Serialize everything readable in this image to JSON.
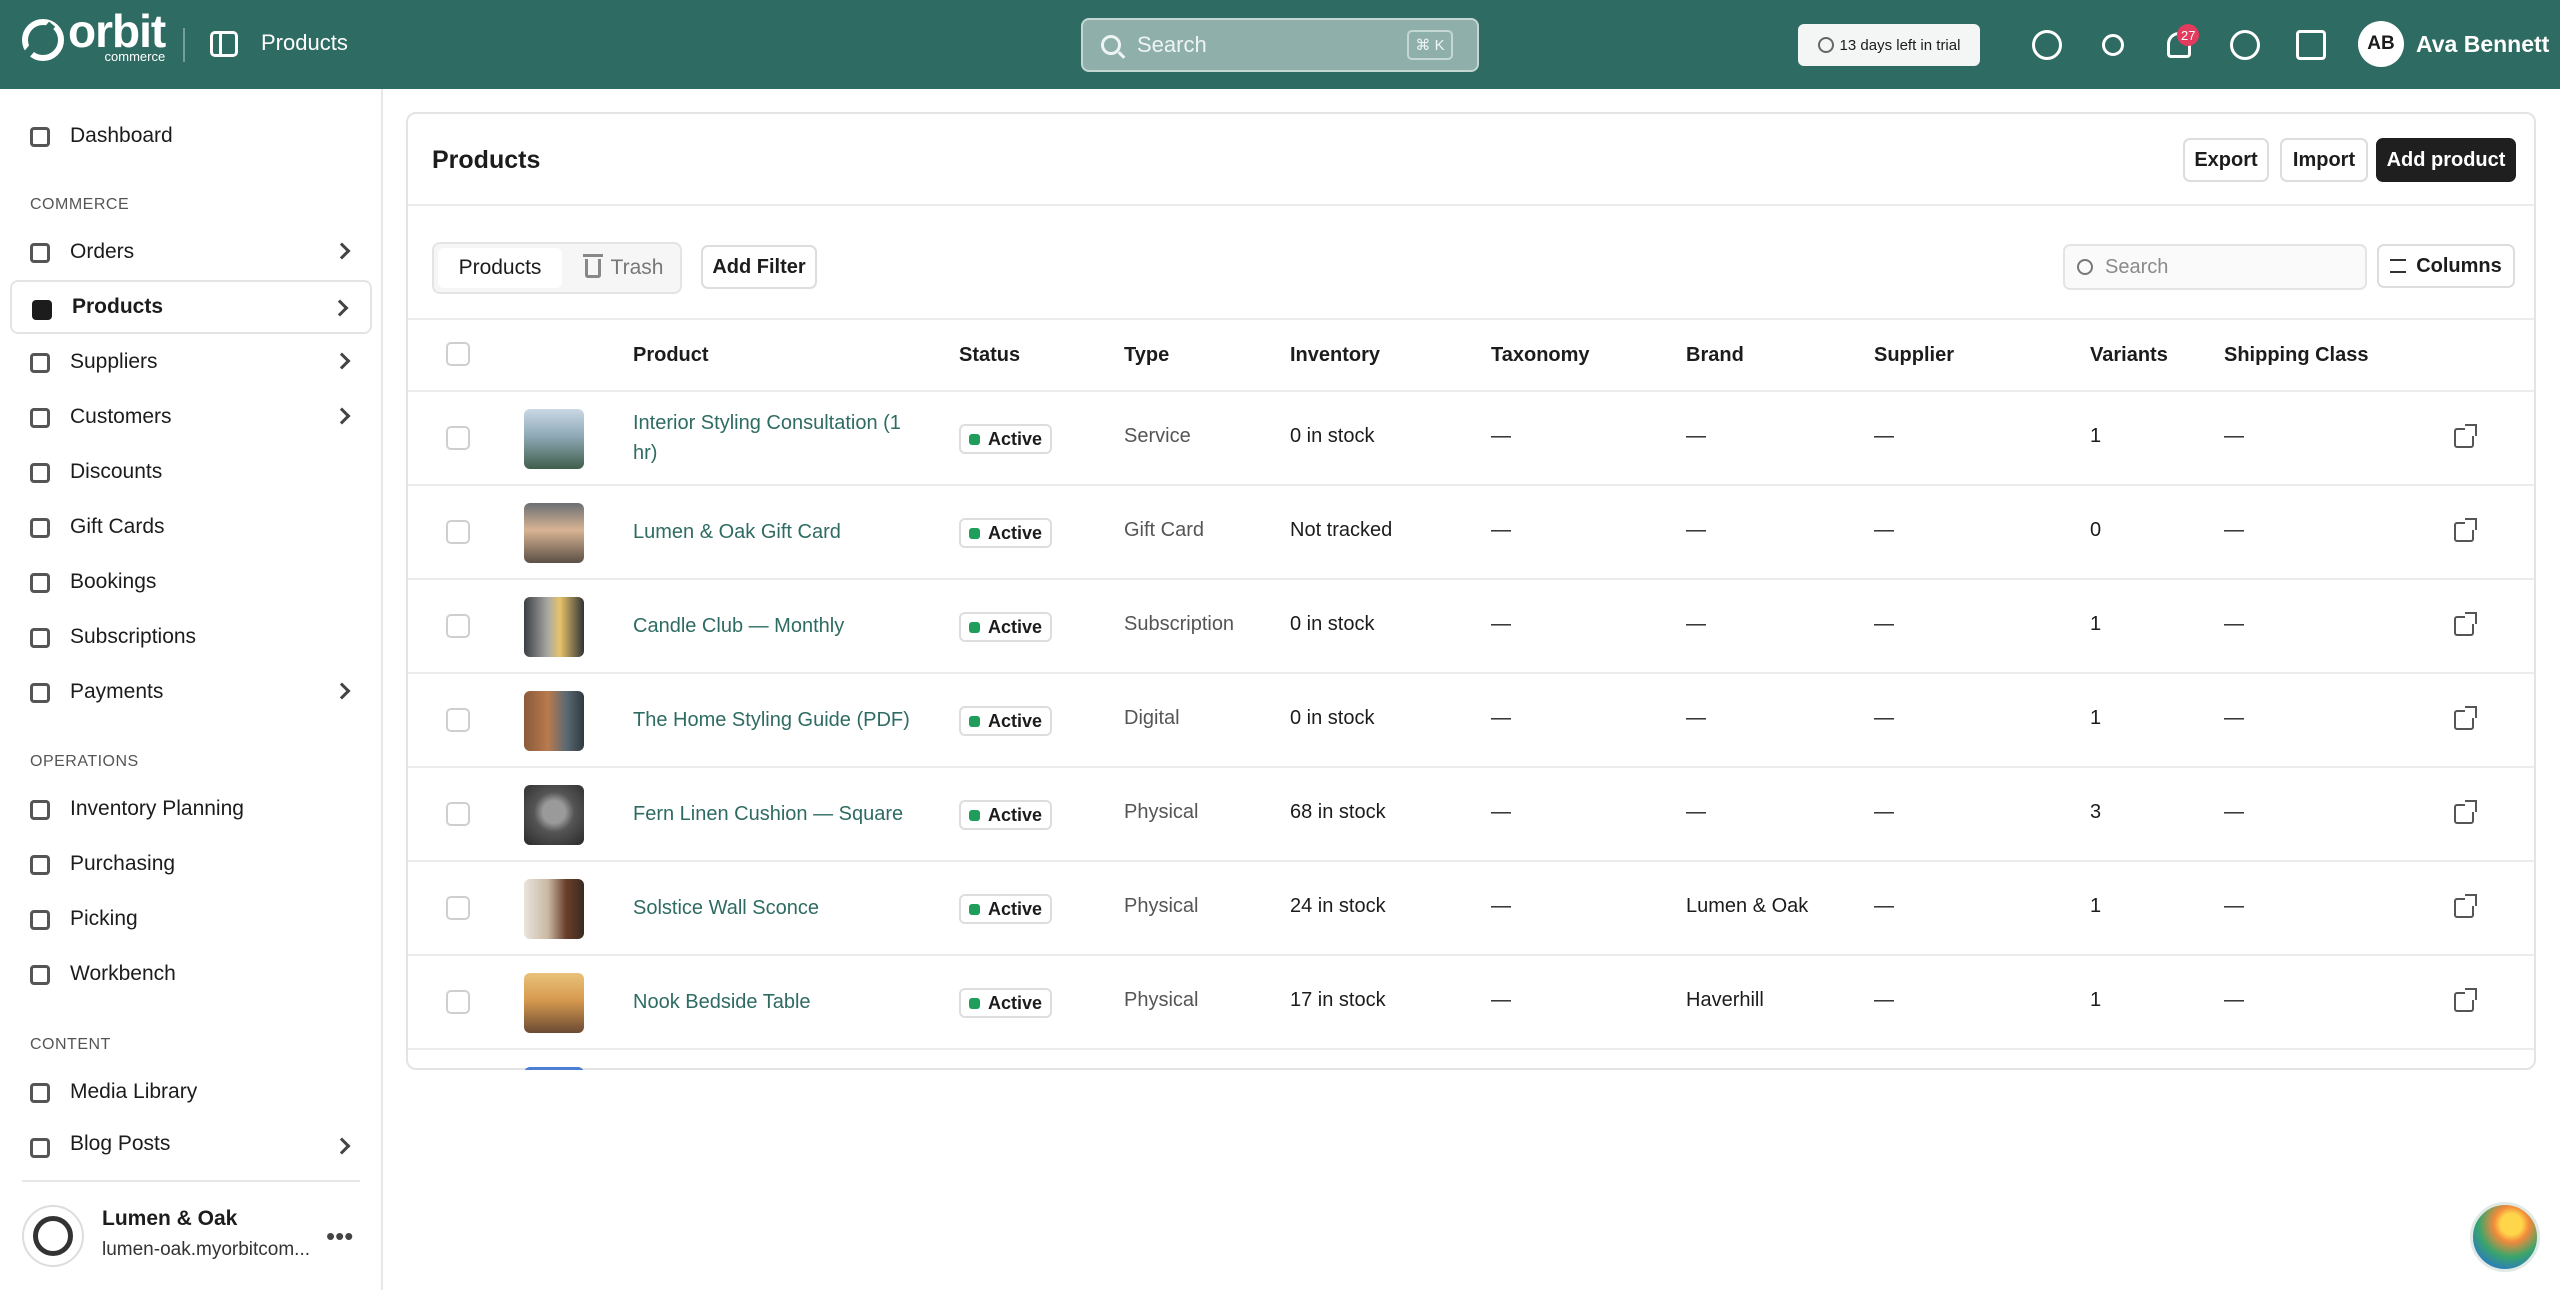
{
  "brand": {
    "name": "orbit",
    "sub": "commerce"
  },
  "topbar": {
    "title": "Products",
    "search_placeholder": "Search",
    "search_shortcut": "⌘ K",
    "trial_text": "13 days left in trial",
    "notifications_count": "27",
    "user_initials": "AB",
    "user_name": "Ava Bennett",
    "icons": [
      "chat-icon",
      "theme-sun-icon",
      "bell-icon",
      "help-icon",
      "store-icon"
    ]
  },
  "sidebar": {
    "top_item": {
      "label": "Dashboard"
    },
    "commerce_label": "COMMERCE",
    "commerce_items": [
      {
        "label": "Orders"
      },
      {
        "label": "Products"
      },
      {
        "label": "Suppliers"
      },
      {
        "label": "Customers"
      },
      {
        "label": "Discounts"
      },
      {
        "label": "Gift Cards"
      },
      {
        "label": "Bookings"
      },
      {
        "label": "Subscriptions"
      },
      {
        "label": "Payments"
      }
    ],
    "operations_label": "OPERATIONS",
    "operations_items": [
      {
        "label": "Inventory Planning"
      },
      {
        "label": "Purchasing"
      },
      {
        "label": "Picking"
      },
      {
        "label": "Workbench"
      }
    ],
    "content_label": "CONTENT",
    "content_items": [
      {
        "label": "Media Library"
      },
      {
        "label": "Blog Posts"
      }
    ],
    "store": {
      "name": "Lumen & Oak",
      "url": "lumen-oak.myorbitcom..."
    }
  },
  "main": {
    "title": "Products",
    "export_label": "Export",
    "import_label": "Import",
    "add_label": "Add product",
    "tab_products": "Products",
    "tab_trash": "Trash",
    "add_filter_label": "Add Filter",
    "search_placeholder": "Search",
    "columns_label": "Columns",
    "headers": [
      "Product",
      "Status",
      "Type",
      "Inventory",
      "Taxonomy",
      "Brand",
      "Supplier",
      "Variants",
      "Shipping Class"
    ],
    "rows": [
      {
        "name": "Interior Styling Consultation (1 hr)",
        "status": "Active",
        "type": "Service",
        "inventory": "0  in stock",
        "taxonomy": "—",
        "brand": "—",
        "supplier": "—",
        "variants": "1",
        "shipping": "—"
      },
      {
        "name": "Lumen & Oak Gift Card",
        "status": "Active",
        "type": "Gift Card",
        "inventory": "Not tracked",
        "taxonomy": "—",
        "brand": "—",
        "supplier": "—",
        "variants": "0",
        "shipping": "—"
      },
      {
        "name": "Candle Club — Monthly",
        "status": "Active",
        "type": "Subscription",
        "inventory": "0  in stock",
        "taxonomy": "—",
        "brand": "—",
        "supplier": "—",
        "variants": "1",
        "shipping": "—"
      },
      {
        "name": "The Home Styling Guide (PDF)",
        "status": "Active",
        "type": "Digital",
        "inventory": "0  in stock",
        "taxonomy": "—",
        "brand": "—",
        "supplier": "—",
        "variants": "1",
        "shipping": "—"
      },
      {
        "name": "Fern Linen Cushion — Square",
        "status": "Active",
        "type": "Physical",
        "inventory": "68  in stock",
        "taxonomy": "—",
        "brand": "—",
        "supplier": "—",
        "variants": "3",
        "shipping": "—"
      },
      {
        "name": "Solstice Wall Sconce",
        "status": "Active",
        "type": "Physical",
        "inventory": "24  in stock",
        "taxonomy": "—",
        "brand": "Lumen & Oak",
        "supplier": "—",
        "variants": "1",
        "shipping": "—"
      },
      {
        "name": "Nook Bedside Table",
        "status": "Active",
        "type": "Physical",
        "inventory": "17  in stock",
        "taxonomy": "—",
        "brand": "Haverhill",
        "supplier": "—",
        "variants": "1",
        "shipping": "—"
      }
    ]
  },
  "colors": {
    "topbar": "#2e6b62",
    "link": "#2e6b62",
    "active_dot": "#1f9d5a",
    "badge": "#e23b5d"
  }
}
